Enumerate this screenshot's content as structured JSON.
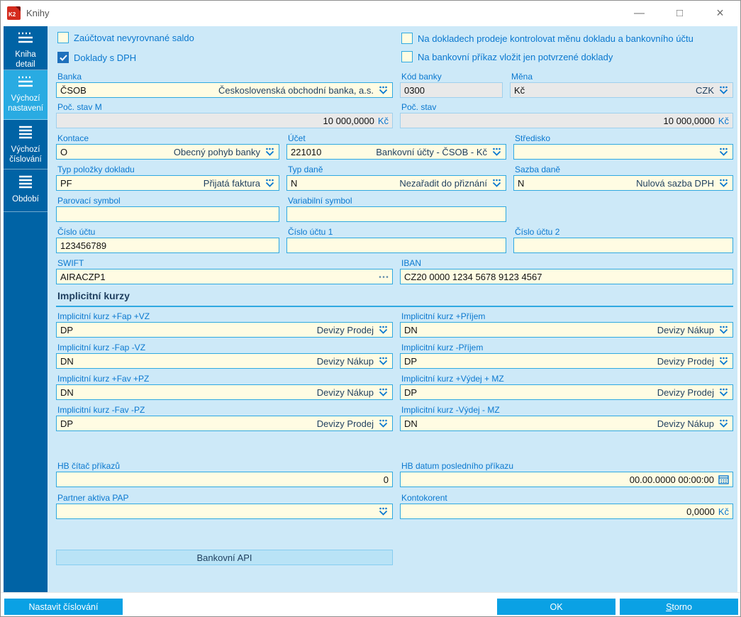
{
  "window": {
    "title": "Knihy",
    "controls": {
      "minimize": "—",
      "maximize": "□",
      "close": "×"
    }
  },
  "sidebar": {
    "items": [
      {
        "label": "Kniha detail",
        "icon": "list-detail-icon",
        "active": false
      },
      {
        "label": "Výchozí nastavení",
        "icon": "list-detail-icon",
        "active": true
      },
      {
        "label": "Výchozí číslování",
        "icon": "menu-lines-icon",
        "active": false
      },
      {
        "label": "Období",
        "icon": "menu-lines-icon",
        "active": false
      }
    ]
  },
  "checkboxes": {
    "zauctovat": {
      "label": "Zaúčtovat nevyrovnané saldo",
      "checked": false
    },
    "doklady_dph": {
      "label": "Doklady s DPH",
      "checked": true
    },
    "kontrola_meny": {
      "label": "Na dokladech prodeje kontrolovat měnu dokladu a bankovního účtu",
      "checked": false
    },
    "potvrzene_doklady": {
      "label": "Na bankovní příkaz vložit jen potvrzené doklady",
      "checked": false
    }
  },
  "fields": {
    "banka": {
      "label": "Banka",
      "value": "ČSOB",
      "desc": "Československá obchodní banka, a.s."
    },
    "kod_banky": {
      "label": "Kód banky",
      "value": "0300"
    },
    "mena": {
      "label": "Měna",
      "value": "Kč",
      "desc": "CZK"
    },
    "poc_stav_m": {
      "label": "Poč. stav M",
      "value": "10 000,0000",
      "suffix": "Kč"
    },
    "poc_stav": {
      "label": "Poč. stav",
      "value": "10 000,0000",
      "suffix": "Kč"
    },
    "kontace": {
      "label": "Kontace",
      "value": "O",
      "desc": "Obecný pohyb banky"
    },
    "ucet": {
      "label": "Účet",
      "value": "221010",
      "desc": "Bankovní účty - ČSOB - Kč"
    },
    "stredisko": {
      "label": "Středisko",
      "value": "",
      "desc": ""
    },
    "typ_polozky": {
      "label": "Typ položky dokladu",
      "value": "PF",
      "desc": "Přijatá faktura"
    },
    "typ_dane": {
      "label": "Typ daně",
      "value": "N",
      "desc": "Nezařadit do přiznání"
    },
    "sazba_dane": {
      "label": "Sazba daně",
      "value": "N",
      "desc": "Nulová sazba DPH"
    },
    "parovaci_symbol": {
      "label": "Parovací symbol",
      "value": ""
    },
    "variabilni_symbol": {
      "label": "Variabilní symbol",
      "value": ""
    },
    "cislo_uctu": {
      "label": "Číslo účtu",
      "value": "123456789"
    },
    "cislo_uctu_1": {
      "label": "Číslo účtu 1",
      "value": ""
    },
    "cislo_uctu_2": {
      "label": "Číslo účtu 2",
      "value": ""
    },
    "swift": {
      "label": "SWIFT",
      "value": "AIRACZP1"
    },
    "iban": {
      "label": "IBAN",
      "value": "CZ20 0000 1234 5678 9123 4567"
    },
    "kurz_fap_plus": {
      "label": "Implicitní kurz +Fap +VZ",
      "value": "DP",
      "desc": "Devizy Prodej"
    },
    "kurz_prijem_plus": {
      "label": "Implicitní kurz +Příjem",
      "value": "DN",
      "desc": "Devizy Nákup"
    },
    "kurz_fap_minus": {
      "label": "Implicitní kurz -Fap -VZ",
      "value": "DN",
      "desc": "Devizy Nákup"
    },
    "kurz_prijem_minus": {
      "label": "Implicitní kurz -Příjem",
      "value": "DP",
      "desc": "Devizy Prodej"
    },
    "kurz_fav_plus": {
      "label": "Implicitní kurz +Fav +PZ",
      "value": "DN",
      "desc": "Devizy Nákup"
    },
    "kurz_vydej_plus": {
      "label": "Implicitní kurz +Výdej + MZ",
      "value": "DP",
      "desc": "Devizy Prodej"
    },
    "kurz_fav_minus": {
      "label": "Implicitní kurz -Fav -PZ",
      "value": "DP",
      "desc": "Devizy Prodej"
    },
    "kurz_vydej_minus": {
      "label": "Implicitní kurz -Výdej - MZ",
      "value": "DN",
      "desc": "Devizy Nákup"
    },
    "hb_citac": {
      "label": "HB čítač příkazů",
      "value": "0"
    },
    "hb_datum": {
      "label": "HB datum posledního příkazu",
      "value": "00.00.0000 00:00:00"
    },
    "partner_pap": {
      "label": "Partner aktiva PAP",
      "value": "",
      "desc": ""
    },
    "kontokorent": {
      "label": "Kontokorent",
      "value": "0,0000",
      "suffix": "Kč"
    }
  },
  "sections": {
    "implicitni_kurzy": "Implicitní kurzy"
  },
  "buttons": {
    "bankovni_api": "Bankovní API",
    "nastavit_cislovani": "Nastavit číslování",
    "ok": "OK",
    "storno": "Storno"
  },
  "colors": {
    "sidebar": "#0063a5",
    "sidebar_active": "#29abe2",
    "content_bg": "#cde9f8",
    "field_bg": "#fffce3",
    "field_border": "#2fa9e1",
    "label_blue": "#0a78cf",
    "button_blue": "#0aa1e4",
    "logo_red": "#d42b1e",
    "checked_blue": "#1e70bc"
  }
}
